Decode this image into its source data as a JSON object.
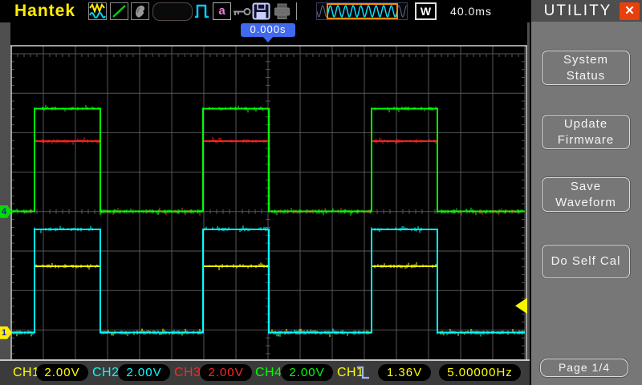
{
  "top_bar": {
    "logo": "Hantek",
    "a_label": "a",
    "w_label": "W",
    "timebase": "40.0ms",
    "icons": [
      "waveform-channels-icon",
      "line-style-icon",
      "hand-icon",
      "pulse-icon",
      "auto-letter-icon",
      "key-icon",
      "save-floppy-icon",
      "print-icon",
      "waveform-preview"
    ]
  },
  "trigger_tag": {
    "position": "0.000s"
  },
  "sidebar": {
    "title": "UTILITY",
    "close_glyph": "✕",
    "buttons": [
      {
        "label": "System\nStatus"
      },
      {
        "label": "Update\nFirmware"
      },
      {
        "label": "Save\nWaveform"
      },
      {
        "label": "Do Self Cal"
      }
    ],
    "page_label": "Page 1/4"
  },
  "markers": {
    "ch4": "4",
    "ch1": "1"
  },
  "status_bar": {
    "channels": [
      {
        "label": "CH1",
        "value": "2.00V",
        "color": "#ffff00"
      },
      {
        "label": "CH2",
        "value": "2.00V",
        "color": "#00ffff"
      },
      {
        "label": "CH3",
        "value": "2.00V",
        "color": "#ff2525"
      },
      {
        "label": "CH4",
        "value": "2.00V",
        "color": "#00ff00"
      }
    ],
    "trigger": {
      "source_label": "CH1",
      "slope": "falling",
      "level": "1.36V",
      "frequency": "5.00000Hz"
    }
  },
  "chart_data": {
    "type": "line",
    "subtype": "oscilloscope-square-waves",
    "title": "UTILITY menu, 4-channel square wave capture",
    "timebase_ms_per_div": 40,
    "divisions": {
      "horizontal": 16,
      "vertical": 8
    },
    "x_range_ms": [
      -320,
      320
    ],
    "trigger": {
      "source": "CH1",
      "level_V": 1.36,
      "position_label": "0.000s",
      "slope": "falling",
      "measured_frequency_Hz": 5.0
    },
    "edges_ms": {
      "rise": [
        -291,
        -81,
        129
      ],
      "fall": [
        -209,
        1,
        211
      ]
    },
    "channels": [
      {
        "name": "CH1",
        "color": "#ffff00",
        "volts_per_div": 2.0,
        "low_V": 0,
        "high_V": 3.37,
        "zero_offset_div_from_center": -3.07
      },
      {
        "name": "CH2",
        "color": "#00ffff",
        "volts_per_div": 2.0,
        "low_V": 0,
        "high_V": 5.24,
        "zero_offset_div_from_center": -3.07
      },
      {
        "name": "CH3",
        "color": "#ff2020",
        "volts_per_div": 2.0,
        "low_V": 0,
        "high_V": 3.57,
        "zero_offset_div_from_center": 0
      },
      {
        "name": "CH4",
        "color": "#00ff00",
        "volts_per_div": 2.0,
        "low_V": 0,
        "high_V": 5.22,
        "zero_offset_div_from_center": 0
      }
    ]
  }
}
